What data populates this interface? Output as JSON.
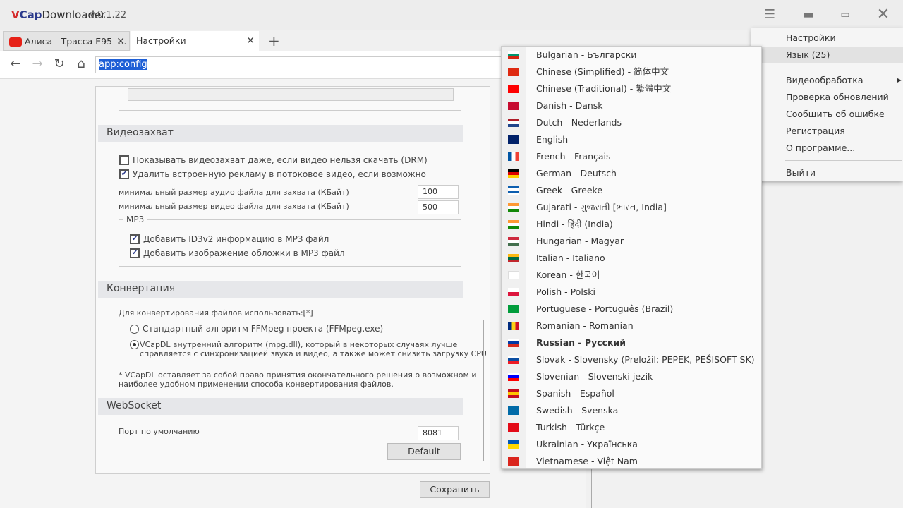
{
  "app": {
    "logo_v": "V",
    "logo_cap": "Cap",
    "logo_rest": "Downloader",
    "version": "v.0.1.22"
  },
  "tabs": [
    {
      "label": "Алиса - Трасса Е95 -..."
    },
    {
      "label": "Настройки"
    }
  ],
  "address": {
    "value": "app:config"
  },
  "settings": {
    "video_capture": {
      "title": "Видеозахват",
      "show_drm": {
        "label": "Показывать видеозахват даже, если видео нельзя скачать (DRM)",
        "checked": false
      },
      "remove_ads": {
        "label": "Удалить встроенную рекламу в потоковое видео, если возможно",
        "checked": true
      },
      "min_audio_label": "минимальный размер аудио файла для захвата (КБайт)",
      "min_audio": "100",
      "min_video_label": "минимальный размер видео файла для захвата (КБайт)",
      "min_video": "500",
      "mp3_group": "MP3",
      "id3": {
        "label": "Добавить ID3v2 информацию в MP3 файл",
        "checked": true
      },
      "cover": {
        "label": "Добавить изображение обложки в MP3 файл",
        "checked": true
      }
    },
    "conversion": {
      "title": "Конвертация",
      "use_label": "Для конвертирования файлов использовать:[*]",
      "opt_ffmpeg": "Стандартный алгоритм FFMpeg проекта (FFMpeg.exe)",
      "opt_internal_1": "VCapDL внутренний алгоритм (mpg.dll), который в некоторых случаях лучше",
      "opt_internal_2": "справляется с синхронизацией звука и видео, а также может снизить загрузку CPU",
      "selected": "internal",
      "note_1": "* VCapDL оставляет за собой право принятия окончательного решения о возможном и",
      "note_2": "наиболее удобном применении способа конвертирования файлов."
    },
    "websocket": {
      "title": "WebSocket",
      "port_label": "Порт по умолчанию",
      "port": "8081",
      "default_btn": "Default"
    },
    "save_btn": "Сохранить"
  },
  "main_menu": [
    "Настройки",
    "Язык (25)",
    "Видеообработка",
    "Проверка обновлений",
    "Сообщить об ошибке",
    "Регистрация",
    "О программе...",
    "Выйти"
  ],
  "languages": [
    {
      "label": "Bulgarian - Български",
      "flag": [
        "#fff",
        "#00966e",
        "#d62612"
      ]
    },
    {
      "label": "Chinese (Simplified) - 简体中文",
      "flag": [
        "#de2910"
      ]
    },
    {
      "label": "Chinese (Traditional) - 繁體中文",
      "flag": [
        "#fe0000"
      ]
    },
    {
      "label": "Danish - Dansk",
      "flag": [
        "#c60c30"
      ]
    },
    {
      "label": "Dutch - Nederlands",
      "flag": [
        "#ae1c28",
        "#fff",
        "#21468b"
      ]
    },
    {
      "label": "English",
      "flag": [
        "#012169"
      ]
    },
    {
      "label": "French - Français",
      "flag": [
        "#0055a4",
        "#fff",
        "#ef4135"
      ],
      "vertical": true
    },
    {
      "label": "German - Deutsch",
      "flag": [
        "#000",
        "#dd0000",
        "#ffce00"
      ]
    },
    {
      "label": "Greek - Greeke",
      "flag": [
        "#0d5eaf",
        "#fff",
        "#0d5eaf",
        "#fff"
      ]
    },
    {
      "label": "Gujarati - ગુજરાતી [ભારત, India]",
      "flag": [
        "#ff9933",
        "#fff",
        "#138808"
      ]
    },
    {
      "label": "Hindi - हिंदी (India)",
      "flag": [
        "#ff9933",
        "#fff",
        "#138808"
      ]
    },
    {
      "label": "Hungarian - Magyar",
      "flag": [
        "#cd2a3e",
        "#fff",
        "#436f4d"
      ]
    },
    {
      "label": "Italian - Italiano",
      "flag": [
        "#fdb913",
        "#006a44",
        "#c1272d"
      ]
    },
    {
      "label": "Korean - 한국어",
      "flag": [
        "#fff"
      ]
    },
    {
      "label": "Polish - Polski",
      "flag": [
        "#fff",
        "#dc143c"
      ]
    },
    {
      "label": "Portuguese - Português (Brazil)",
      "flag": [
        "#009c3b"
      ]
    },
    {
      "label": "Romanian - Romanian",
      "flag": [
        "#002b7f",
        "#fcd116",
        "#ce1126"
      ],
      "vertical": true
    },
    {
      "label": "Russian - Русский",
      "flag": [
        "#fff",
        "#0039a6",
        "#d52b1e"
      ],
      "selected": true
    },
    {
      "label": "Slovak - Slovensky (Preložil: PEPEK, PEŠISOFT SK)",
      "flag": [
        "#fff",
        "#0b4ea2",
        "#ee1c25"
      ]
    },
    {
      "label": "Slovenian - Slovenski jezik",
      "flag": [
        "#fff",
        "#0000ff",
        "#ff0000"
      ]
    },
    {
      "label": "Spanish - Español",
      "flag": [
        "#c60b1e",
        "#ffc400",
        "#c60b1e"
      ]
    },
    {
      "label": "Swedish - Svenska",
      "flag": [
        "#006aa7"
      ]
    },
    {
      "label": "Turkish - Türkçe",
      "flag": [
        "#e30a17"
      ]
    },
    {
      "label": "Ukrainian - Українська",
      "flag": [
        "#0057b7",
        "#ffd700"
      ]
    },
    {
      "label": "Vietnamese - Việt Nam",
      "flag": [
        "#da251d"
      ]
    }
  ]
}
